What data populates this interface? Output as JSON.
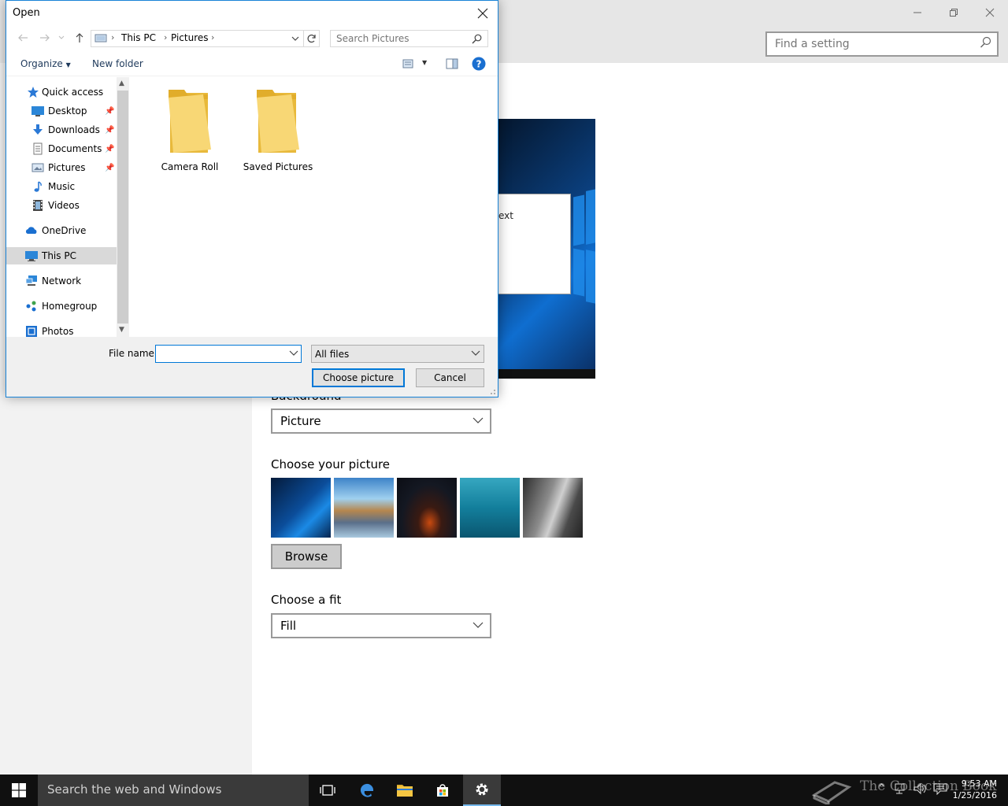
{
  "settings": {
    "find_placeholder": "Find a setting",
    "preview_text": "ext",
    "background_label": "Background",
    "background_value": "Picture",
    "choose_picture_label": "Choose your picture",
    "browse_label": "Browse",
    "choose_fit_label": "Choose a fit",
    "fit_value": "Fill"
  },
  "dialog": {
    "title": "Open",
    "breadcrumb": [
      "This PC",
      "Pictures"
    ],
    "search_placeholder": "Search Pictures",
    "organize_label": "Organize",
    "new_folder_label": "New folder",
    "nav_items": [
      {
        "label": "Quick access",
        "icon": "star-icon"
      },
      {
        "label": "Desktop",
        "icon": "desktop-icon",
        "pinned": true
      },
      {
        "label": "Downloads",
        "icon": "download-icon",
        "pinned": true
      },
      {
        "label": "Documents",
        "icon": "documents-icon",
        "pinned": true
      },
      {
        "label": "Pictures",
        "icon": "pictures-icon",
        "pinned": true
      },
      {
        "label": "Music",
        "icon": "music-icon"
      },
      {
        "label": "Videos",
        "icon": "videos-icon"
      },
      {
        "label": "OneDrive",
        "icon": "cloud-icon"
      },
      {
        "label": "This PC",
        "icon": "computer-icon",
        "selected": true
      },
      {
        "label": "Network",
        "icon": "network-icon"
      },
      {
        "label": "Homegroup",
        "icon": "homegroup-icon"
      },
      {
        "label": "Photos",
        "icon": "photos-icon"
      }
    ],
    "folders": [
      "Camera Roll",
      "Saved Pictures"
    ],
    "file_name_label": "File name:",
    "file_name_value": "",
    "file_type_value": "All files",
    "choose_button": "Choose picture",
    "cancel_button": "Cancel"
  },
  "taskbar": {
    "search_placeholder": "Search the web and Windows",
    "time": "9:53 AM",
    "date": "1/25/2016",
    "watermark": "The Collection Book"
  },
  "colors": {
    "accent": "#0078d7",
    "folder": "#f8d775",
    "taskbar": "#101010"
  }
}
